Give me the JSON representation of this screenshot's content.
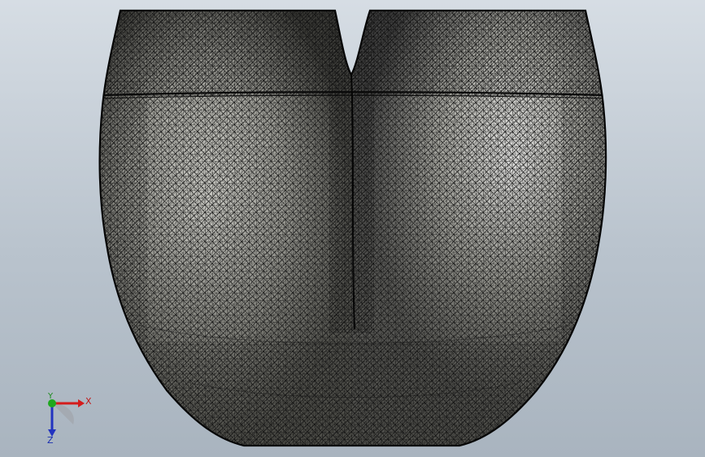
{
  "viewport": {
    "background_top": "#d6dde4",
    "background_bottom": "#a9b4bf"
  },
  "model": {
    "description_icon": "mesh-vessel-icon",
    "mesh_color": "#111111",
    "surface_light": "#f4f4f0",
    "surface_dark": "#6f6f6a"
  },
  "triad": {
    "x_label": "X",
    "y_label": "Y",
    "z_label": "Z",
    "x_color": "#d41c1c",
    "y_color": "#1ea81e",
    "z_color": "#2233c0"
  }
}
